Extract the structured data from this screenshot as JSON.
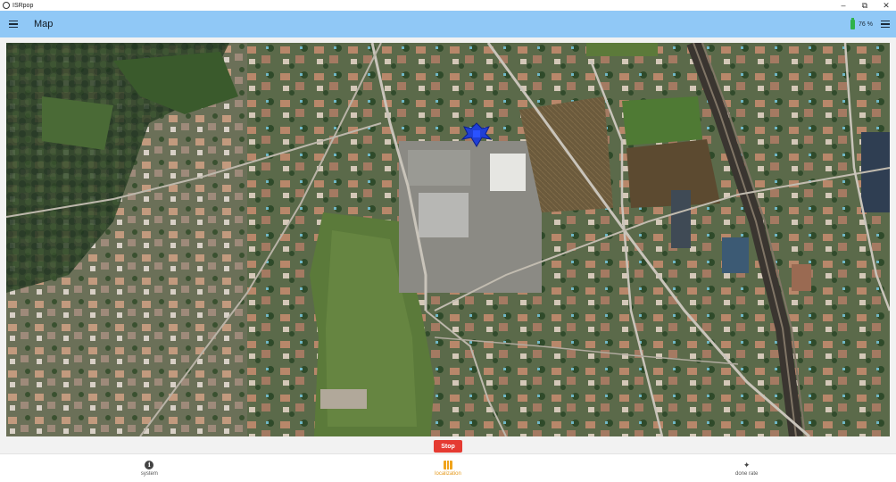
{
  "window": {
    "title": "ISRpop",
    "controls": [
      "minimize-icon",
      "maximize-icon",
      "close-icon"
    ]
  },
  "appbar": {
    "title": "Map",
    "battery": {
      "level_percent": 76,
      "text": "76 %",
      "color": "#2fb24a"
    },
    "accent_color": "#90c8f6"
  },
  "map": {
    "type": "satellite",
    "marker": {
      "icon": "drone-icon",
      "color": "#1f3fd6"
    }
  },
  "controls": {
    "stop_label": "Stop",
    "stop_color": "#e53b32"
  },
  "bottom_nav": {
    "items": [
      {
        "label": "system",
        "icon": "info-icon",
        "active": false
      },
      {
        "label": "localization",
        "icon": "map-icon",
        "active": true
      },
      {
        "label": "done rate",
        "icon": "drone-icon",
        "active": false
      }
    ],
    "active_color": "#e59a1c"
  }
}
